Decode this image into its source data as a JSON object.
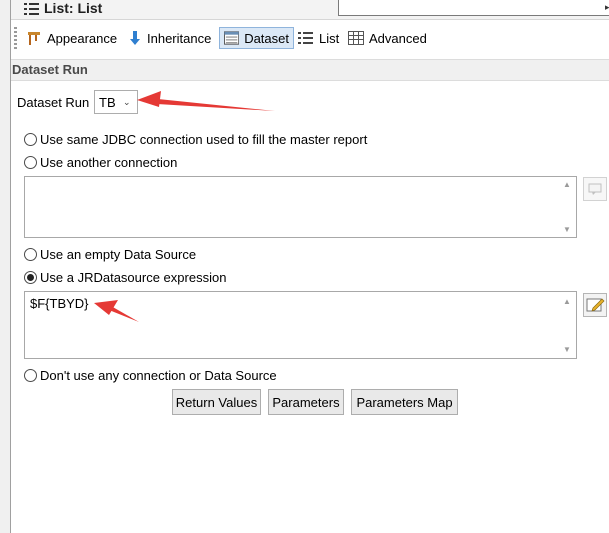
{
  "window": {
    "title": "List: List"
  },
  "tabs": [
    {
      "label": "Appearance",
      "icon": "appearance-icon"
    },
    {
      "label": "Inheritance",
      "icon": "inheritance-icon"
    },
    {
      "label": "Dataset",
      "icon": "dataset-icon",
      "active": true
    },
    {
      "label": "List",
      "icon": "list-icon"
    },
    {
      "label": "Advanced",
      "icon": "advanced-icon"
    }
  ],
  "section": {
    "title": "Dataset Run"
  },
  "dataset_run": {
    "label": "Dataset Run",
    "value": "TB"
  },
  "options": {
    "same_jdbc": "Use same JDBC connection used to fill the master report",
    "another_connection": "Use another connection",
    "empty_source": "Use an empty Data Source",
    "jr_expression": "Use a JRDatasource expression",
    "no_connection": "Don't use any connection or Data Source",
    "selected": "jr_expression"
  },
  "expression": {
    "value": "$F{TBYD}"
  },
  "buttons": {
    "return_values": "Return Values",
    "parameters": "Parameters",
    "parameters_map": "Parameters Map"
  },
  "colors": {
    "annotation_arrow": "#e53935",
    "active_tab": "#dbe8f6"
  }
}
